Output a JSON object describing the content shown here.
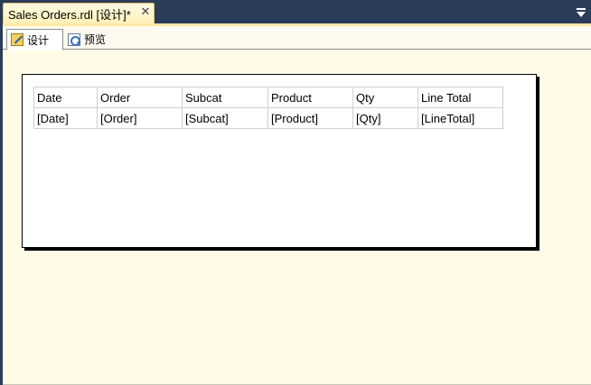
{
  "document_tab": {
    "title": "Sales Orders.rdl [设计]*",
    "close_glyph": "✕"
  },
  "view_tabs": [
    {
      "label": "设计",
      "icon": "design-icon",
      "active": true
    },
    {
      "label": "预览",
      "icon": "preview-icon",
      "active": false
    }
  ],
  "report": {
    "headers": [
      "Date",
      "Order",
      "Subcat",
      "Product",
      "Qty",
      "Line Total"
    ],
    "fields": [
      "[Date]",
      "[Order]",
      "[Subcat]",
      "[Product]",
      "[Qty]",
      "[LineTotal]"
    ]
  },
  "colors": {
    "frame": "#2b3c59",
    "tab_accent": "#ffe8a6",
    "canvas": "#fffbe6"
  }
}
